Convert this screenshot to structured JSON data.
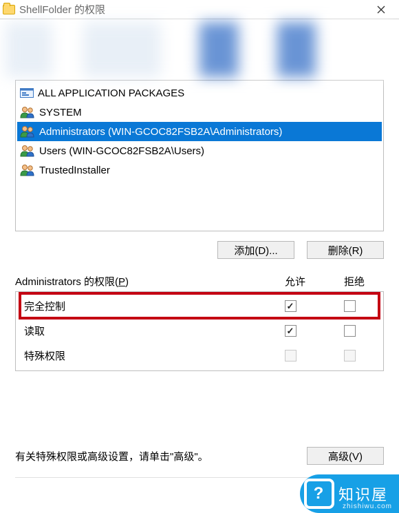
{
  "titlebar": {
    "title": "ShellFolder 的权限"
  },
  "principals": [
    {
      "icon": "package",
      "label": "ALL APPLICATION PACKAGES",
      "selected": false
    },
    {
      "icon": "users",
      "label": "SYSTEM",
      "selected": false
    },
    {
      "icon": "users",
      "label": "Administrators (WIN-GCOC82FSB2A\\Administrators)",
      "selected": true
    },
    {
      "icon": "users",
      "label": "Users (WIN-GCOC82FSB2A\\Users)",
      "selected": false
    },
    {
      "icon": "users",
      "label": "TrustedInstaller",
      "selected": false
    }
  ],
  "buttons": {
    "add": "添加(D)...",
    "remove": "删除(R)",
    "advanced": "高级(V)"
  },
  "perm_header": {
    "label_prefix": "Administrators 的权限(",
    "label_hotkey": "P",
    "label_suffix": ")",
    "allow": "允许",
    "deny": "拒绝"
  },
  "permissions": [
    {
      "name": "完全控制",
      "allow": true,
      "deny": false,
      "highlight": true,
      "allow_enabled": true,
      "deny_enabled": true
    },
    {
      "name": "读取",
      "allow": true,
      "deny": false,
      "highlight": false,
      "allow_enabled": true,
      "deny_enabled": true
    },
    {
      "name": "特殊权限",
      "allow": false,
      "deny": false,
      "highlight": false,
      "allow_enabled": false,
      "deny_enabled": false
    }
  ],
  "footer_text": "有关特殊权限或高级设置，请单击\"高级\"。",
  "watermark": {
    "brand": "知识屋",
    "site": "zhishiwu.com"
  }
}
